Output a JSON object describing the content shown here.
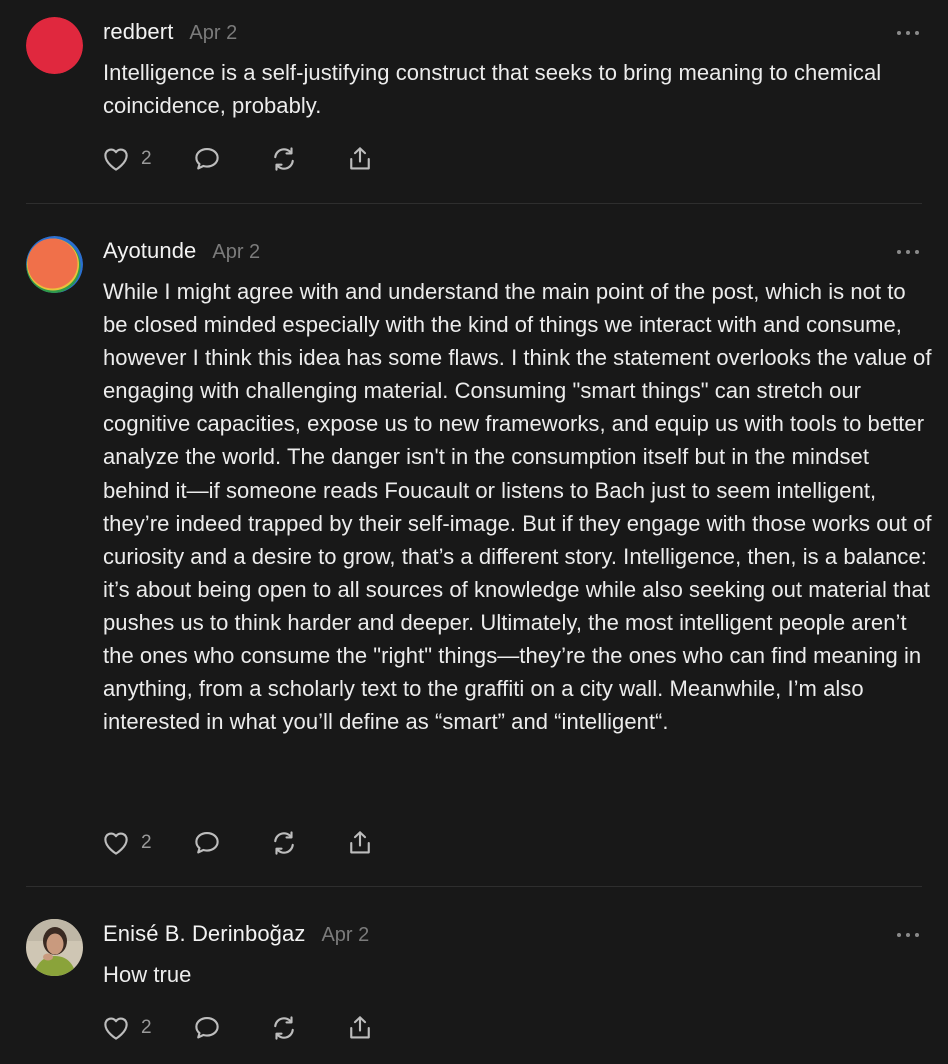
{
  "posts": [
    {
      "username": "redbert",
      "date": "Apr 2",
      "text": "Intelligence is a self-justifying construct that seeks to bring meaning to chemical coincidence, probably.",
      "likes": "2",
      "avatar_color": "#e0283e"
    },
    {
      "username": "Ayotunde",
      "date": "Apr 2",
      "text": "While I might agree with and understand the main point of the post, which is not to be closed minded especially with the kind of things we interact with and consume, however I think this idea has some flaws. I think the statement overlooks the value of engaging with challenging material. Consuming \"smart things\" can stretch our cognitive capacities, expose us to new frameworks, and equip us with tools to better analyze the world. The danger isn't in the consumption itself but in the mindset behind it—if someone reads Foucault or listens to Bach just to seem intelligent, they’re indeed trapped by their self-image. But if they engage with those works out of curiosity and a desire to grow, that’s a different story. Intelligence, then, is a balance: it’s about being open to all sources of knowledge while also seeking out material that pushes us to think harder and deeper. Ultimately, the most intelligent people aren’t the ones who consume the \"right\" things—they’re the ones who can find meaning in anything, from a scholarly text to the graffiti on a city wall. Meanwhile, I’m also interested in what you’ll define as “smart” and “intelligent“.",
      "likes": "2",
      "avatar_color": "#f0704a"
    },
    {
      "username": "Enisé B. Derinboğaz",
      "date": "Apr 2",
      "text": "How true",
      "likes": "2",
      "avatar_color": "#8aa36a"
    }
  ],
  "icons": {
    "more": "more-icon",
    "like": "heart-icon",
    "comment": "comment-icon",
    "restack": "restack-icon",
    "share": "share-icon"
  },
  "colors": {
    "background": "#181818",
    "text": "#ececec",
    "muted": "#7b7b7b",
    "icon": "#bdbdbd"
  }
}
